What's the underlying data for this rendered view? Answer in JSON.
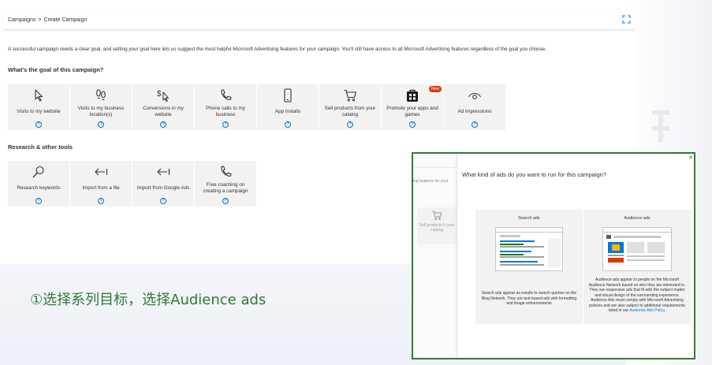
{
  "breadcrumb": {
    "root": "Campaigns",
    "separator": ">",
    "current": "Create Campaign"
  },
  "intro_text": "A successful campaign needs a clear goal, and setting your goal here lets us suggest the most helpful Microsoft Advertising features for your campaign. You'll still have access to all Microsoft Advertising features regardless of the goal you choose.",
  "goal_section": {
    "title": "What's the goal of this campaign?",
    "tiles": [
      {
        "label": "Visits to my website",
        "icon": "cursor-icon"
      },
      {
        "label": "Visits to my business location(s)",
        "icon": "footprints-icon"
      },
      {
        "label": "Conversions in my website",
        "icon": "dollar-cursor-icon"
      },
      {
        "label": "Phone calls to my business",
        "icon": "phone-icon"
      },
      {
        "label": "App installs",
        "icon": "mobile-icon"
      },
      {
        "label": "Sell products from your catalog",
        "icon": "cart-icon"
      },
      {
        "label": "Promote your apps and games",
        "icon": "store-icon",
        "badge": "New"
      },
      {
        "label": "Ad impressions",
        "icon": "eye-icon"
      }
    ]
  },
  "tools_section": {
    "title": "Research & other tools",
    "tiles": [
      {
        "label": "Research keywords",
        "icon": "search-icon"
      },
      {
        "label": "Import from a file",
        "icon": "import-icon"
      },
      {
        "label": "Import from Google Ads",
        "icon": "import-icon"
      },
      {
        "label": "Free coaching on creating a campaign",
        "icon": "phone-icon"
      }
    ]
  },
  "help_glyph": "?",
  "caption": "①选择系列目标，选择Audience ads",
  "popup": {
    "ghost_intro": "ing features for your",
    "ghost_tile_label": "Sell products fr your catalog",
    "title": "What kind of ads do you want to run for this campaign?",
    "cards": [
      {
        "title": "Search ads",
        "description": "Search ads appear as results to search queries on the Bing Network. They are text-based ads with formatting and image enhancements"
      },
      {
        "title": "Audience ads",
        "description": "Audience ads appear to people on the Microsoft Audience Network based on who they are interested in. They are responsive ads that fit with the subject matter and visual design of the surrounding experience. Audience Ads must comply with Microsoft Advertising policies and are also subject to additional requirements listed in our",
        "link": "Audience Ads Policy."
      }
    ]
  },
  "colors": {
    "accent": "#0078d4",
    "highlight_border": "#2e7d32",
    "caption": "#2e7d32",
    "badge": "#d83b01",
    "tile_bg": "#f3f2f1"
  }
}
